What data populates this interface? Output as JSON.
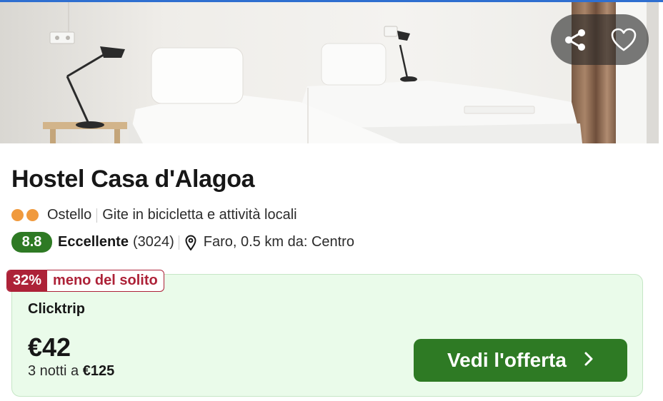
{
  "hotel": {
    "name": "Hostel Casa d'Alagoa",
    "type": "Ostello",
    "highlight": "Gite in bicicletta e attività locali",
    "rating_score": "8.8",
    "rating_label": "Eccellente",
    "reviews_count": "(3024)",
    "location": "Faro, 0.5 km da: Centro",
    "class_dots": 2
  },
  "photo_actions": {
    "share_icon": "share-icon",
    "favorite_icon": "heart-icon"
  },
  "deal": {
    "discount_pct": "32%",
    "discount_text": "meno del solito",
    "provider": "Clicktrip",
    "price": "€42",
    "nights_prefix": "3 notti a ",
    "nights_total": "€125",
    "cta_label": "Vedi l'offerta"
  },
  "colors": {
    "accent_green": "#2e7a24",
    "deal_bg": "#eafbea",
    "discount_red": "#ad2238",
    "class_dot": "#f09a3e"
  }
}
